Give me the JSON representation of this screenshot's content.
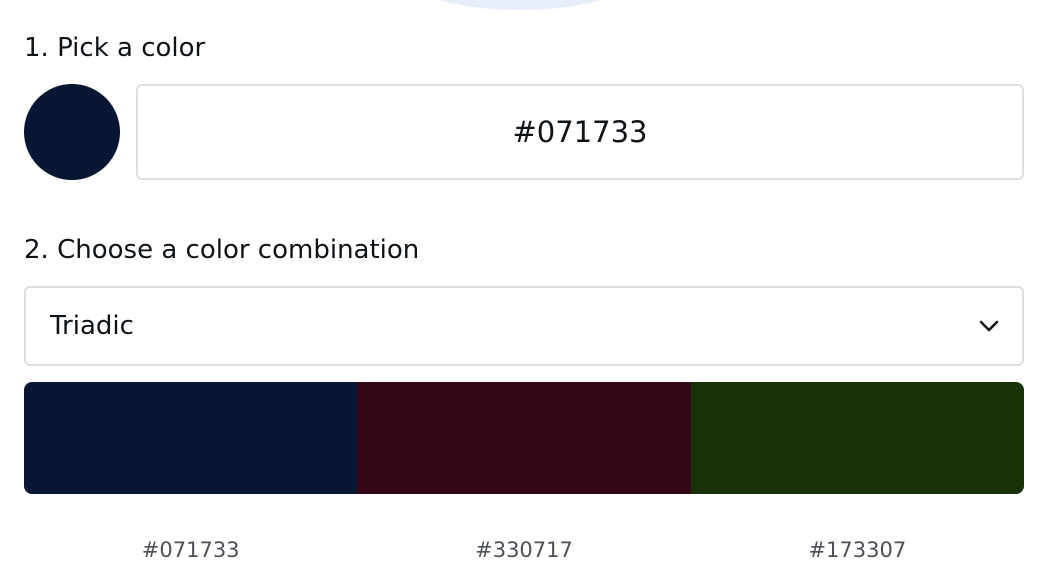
{
  "step1": {
    "heading": "1. Pick a color",
    "selected_color": "#071733",
    "hex_value": "#071733"
  },
  "step2": {
    "heading": "2. Choose a color combination",
    "combination": "Triadic"
  },
  "palette": [
    {
      "color": "#071733",
      "label": "#071733"
    },
    {
      "color": "#330717",
      "label": "#330717"
    },
    {
      "color": "#173307",
      "label": "#173307"
    }
  ],
  "icons": {
    "dropdown": "chevron-down-icon"
  },
  "colors": {
    "text": "#0e1318",
    "secondary_text": "#4d5157",
    "border": "#dcdee2",
    "arc": "#e8edfb"
  }
}
